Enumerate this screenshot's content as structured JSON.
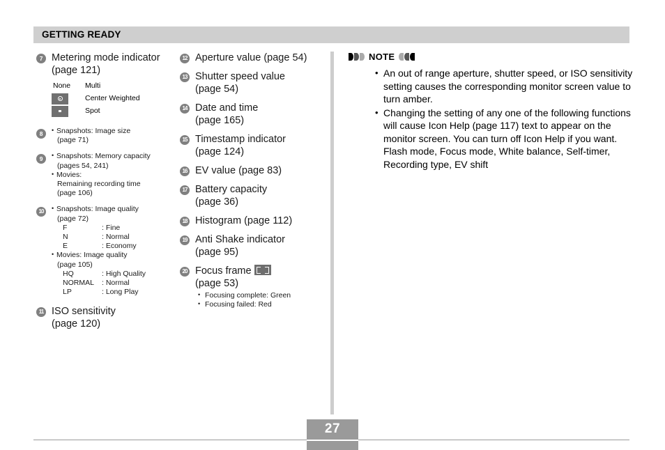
{
  "header": {
    "title": "GETTING READY"
  },
  "left_column": [
    {
      "num": "7",
      "title": "Metering mode indicator",
      "page": "(page 121)",
      "meter_table": [
        {
          "key_type": "text",
          "key": "None",
          "label": "Multi",
          "icon": ""
        },
        {
          "key_type": "icon",
          "key": "",
          "label": "Center Weighted",
          "icon": "center-weighted-metering-icon"
        },
        {
          "key_type": "icon",
          "key": "",
          "label": "Spot",
          "icon": "spot-metering-icon"
        }
      ]
    },
    {
      "num": "8",
      "bullets": [
        {
          "text": "Snapshots: Image size",
          "sub": [
            "(page 71)"
          ]
        }
      ]
    },
    {
      "num": "9",
      "bullets": [
        {
          "text": "Snapshots: Memory capacity",
          "sub": [
            "(pages 54, 241)"
          ]
        },
        {
          "text": "Movies:",
          "sub": [
            "Remaining recording time",
            "(page 106)"
          ]
        }
      ]
    },
    {
      "num": "10",
      "bullets": [
        {
          "text": "Snapshots: Image quality",
          "sub": [
            "(page 72)"
          ],
          "pairs": [
            {
              "k": "F",
              "v": ": Fine"
            },
            {
              "k": "N",
              "v": ": Normal"
            },
            {
              "k": "E",
              "v": ": Economy"
            }
          ]
        },
        {
          "text": "Movies: Image quality",
          "sub": [
            "(page 105)"
          ],
          "pairs": [
            {
              "k": "HQ",
              "v": ": High Quality"
            },
            {
              "k": "NORMAL",
              "v": ": Normal"
            },
            {
              "k": "LP",
              "v": ": Long Play"
            }
          ]
        }
      ]
    },
    {
      "num": "11",
      "title": "ISO sensitivity",
      "page": "(page 120)"
    }
  ],
  "middle_column": [
    {
      "num": "12",
      "title": "Aperture value (page 54)",
      "page": ""
    },
    {
      "num": "13",
      "title": "Shutter speed value",
      "page": "(page 54)"
    },
    {
      "num": "14",
      "title": "Date and time",
      "page": "(page 165)"
    },
    {
      "num": "15",
      "title": "Timestamp indicator",
      "page": "(page 124)"
    },
    {
      "num": "16",
      "title": "EV value (page 83)",
      "page": ""
    },
    {
      "num": "17",
      "title": "Battery capacity",
      "page": "(page 36)"
    },
    {
      "num": "18",
      "title": "Histogram (page 112)",
      "page": ""
    },
    {
      "num": "19",
      "title": "Anti Shake indicator",
      "page": "(page 95)"
    },
    {
      "num": "20",
      "title": "Focus frame",
      "page": "(page 53)",
      "icon": "focus-frame-icon",
      "subnotes": [
        "Focusing complete: Green",
        "Focusing failed: Red"
      ]
    }
  ],
  "note": {
    "title": "NOTE",
    "items": [
      "An out of range aperture, shutter speed, or ISO sensitivity setting causes the corresponding monitor screen value to turn amber.",
      "Changing the setting of any one of the following functions will cause Icon Help (page 117) text to appear on the monitor screen. You can turn off Icon Help if you want.\nFlash mode, Focus mode, White balance, Self-timer, Recording type, EV shift"
    ]
  },
  "footer": {
    "page_number": "27"
  },
  "colors": {
    "header_bar": "#cfcfcf",
    "badge": "#808080",
    "divider": "#cdcdcd",
    "footer_box": "#9a9a9a",
    "icon_box": "#707070"
  }
}
